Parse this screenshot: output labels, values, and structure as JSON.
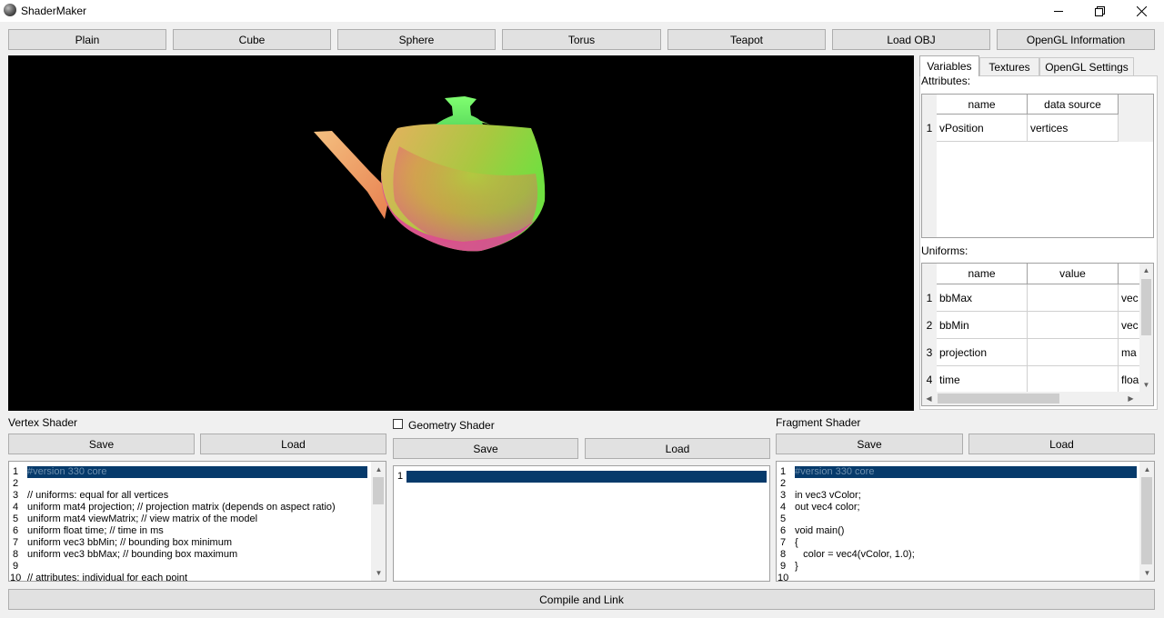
{
  "window": {
    "title": "ShaderMaker"
  },
  "toolbar": {
    "plain": "Plain",
    "cube": "Cube",
    "sphere": "Sphere",
    "torus": "Torus",
    "teapot": "Teapot",
    "load_obj": "Load OBJ",
    "opengl_info": "OpenGL Information"
  },
  "tabs": {
    "variables": "Variables",
    "textures": "Textures",
    "opengl_settings": "OpenGL Settings"
  },
  "attributes": {
    "label": "Attributes:",
    "columns": [
      "name",
      "data source"
    ],
    "rows": [
      {
        "index": "1",
        "name": "vPosition",
        "source": "vertices"
      }
    ]
  },
  "uniforms": {
    "label": "Uniforms:",
    "columns": [
      "name",
      "value"
    ],
    "rows": [
      {
        "index": "1",
        "name": "bbMax",
        "value": "",
        "type": "vec"
      },
      {
        "index": "2",
        "name": "bbMin",
        "value": "",
        "type": "vec"
      },
      {
        "index": "3",
        "name": "projection",
        "value": "",
        "type": "ma"
      },
      {
        "index": "4",
        "name": "time",
        "value": "",
        "type": "floa"
      }
    ]
  },
  "vertex_shader": {
    "label": "Vertex Shader",
    "save": "Save",
    "load": "Load",
    "lines": [
      "#version 330 core",
      "",
      "// uniforms: equal for all vertices",
      "uniform mat4 projection; // projection matrix (depends on aspect ratio)",
      "uniform mat4 viewMatrix; // view matrix of the model",
      "uniform float time; // time in ms",
      "uniform vec3 bbMin; // bounding box minimum",
      "uniform vec3 bbMax; // bounding box maximum",
      "",
      "// attributes: individual for each point"
    ]
  },
  "geometry_shader": {
    "label": "Geometry Shader",
    "enabled": false,
    "save": "Save",
    "load": "Load",
    "lines": [
      ""
    ]
  },
  "fragment_shader": {
    "label": "Fragment Shader",
    "save": "Save",
    "load": "Load",
    "lines": [
      "#version 330 core",
      "",
      "in vec3 vColor;",
      "out vec4 color;",
      "",
      "void main()",
      "{",
      "   color = vec4(vColor, 1.0);",
      "}",
      ""
    ]
  },
  "compile_button": "Compile and Link",
  "colors": {
    "selection": "#063a6b",
    "viewport_bg": "#000000"
  }
}
